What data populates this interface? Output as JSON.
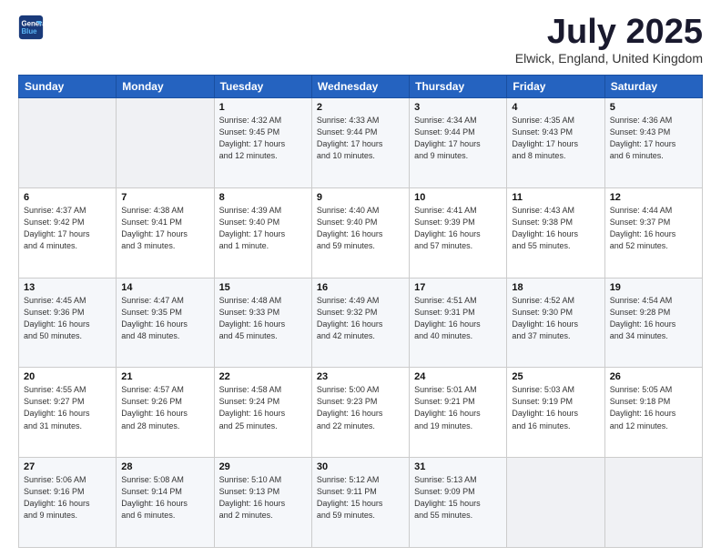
{
  "header": {
    "logo_line1": "General",
    "logo_line2": "Blue",
    "month": "July 2025",
    "location": "Elwick, England, United Kingdom"
  },
  "days_of_week": [
    "Sunday",
    "Monday",
    "Tuesday",
    "Wednesday",
    "Thursday",
    "Friday",
    "Saturday"
  ],
  "weeks": [
    [
      {
        "num": "",
        "info": ""
      },
      {
        "num": "",
        "info": ""
      },
      {
        "num": "1",
        "info": "Sunrise: 4:32 AM\nSunset: 9:45 PM\nDaylight: 17 hours\nand 12 minutes."
      },
      {
        "num": "2",
        "info": "Sunrise: 4:33 AM\nSunset: 9:44 PM\nDaylight: 17 hours\nand 10 minutes."
      },
      {
        "num": "3",
        "info": "Sunrise: 4:34 AM\nSunset: 9:44 PM\nDaylight: 17 hours\nand 9 minutes."
      },
      {
        "num": "4",
        "info": "Sunrise: 4:35 AM\nSunset: 9:43 PM\nDaylight: 17 hours\nand 8 minutes."
      },
      {
        "num": "5",
        "info": "Sunrise: 4:36 AM\nSunset: 9:43 PM\nDaylight: 17 hours\nand 6 minutes."
      }
    ],
    [
      {
        "num": "6",
        "info": "Sunrise: 4:37 AM\nSunset: 9:42 PM\nDaylight: 17 hours\nand 4 minutes."
      },
      {
        "num": "7",
        "info": "Sunrise: 4:38 AM\nSunset: 9:41 PM\nDaylight: 17 hours\nand 3 minutes."
      },
      {
        "num": "8",
        "info": "Sunrise: 4:39 AM\nSunset: 9:40 PM\nDaylight: 17 hours\nand 1 minute."
      },
      {
        "num": "9",
        "info": "Sunrise: 4:40 AM\nSunset: 9:40 PM\nDaylight: 16 hours\nand 59 minutes."
      },
      {
        "num": "10",
        "info": "Sunrise: 4:41 AM\nSunset: 9:39 PM\nDaylight: 16 hours\nand 57 minutes."
      },
      {
        "num": "11",
        "info": "Sunrise: 4:43 AM\nSunset: 9:38 PM\nDaylight: 16 hours\nand 55 minutes."
      },
      {
        "num": "12",
        "info": "Sunrise: 4:44 AM\nSunset: 9:37 PM\nDaylight: 16 hours\nand 52 minutes."
      }
    ],
    [
      {
        "num": "13",
        "info": "Sunrise: 4:45 AM\nSunset: 9:36 PM\nDaylight: 16 hours\nand 50 minutes."
      },
      {
        "num": "14",
        "info": "Sunrise: 4:47 AM\nSunset: 9:35 PM\nDaylight: 16 hours\nand 48 minutes."
      },
      {
        "num": "15",
        "info": "Sunrise: 4:48 AM\nSunset: 9:33 PM\nDaylight: 16 hours\nand 45 minutes."
      },
      {
        "num": "16",
        "info": "Sunrise: 4:49 AM\nSunset: 9:32 PM\nDaylight: 16 hours\nand 42 minutes."
      },
      {
        "num": "17",
        "info": "Sunrise: 4:51 AM\nSunset: 9:31 PM\nDaylight: 16 hours\nand 40 minutes."
      },
      {
        "num": "18",
        "info": "Sunrise: 4:52 AM\nSunset: 9:30 PM\nDaylight: 16 hours\nand 37 minutes."
      },
      {
        "num": "19",
        "info": "Sunrise: 4:54 AM\nSunset: 9:28 PM\nDaylight: 16 hours\nand 34 minutes."
      }
    ],
    [
      {
        "num": "20",
        "info": "Sunrise: 4:55 AM\nSunset: 9:27 PM\nDaylight: 16 hours\nand 31 minutes."
      },
      {
        "num": "21",
        "info": "Sunrise: 4:57 AM\nSunset: 9:26 PM\nDaylight: 16 hours\nand 28 minutes."
      },
      {
        "num": "22",
        "info": "Sunrise: 4:58 AM\nSunset: 9:24 PM\nDaylight: 16 hours\nand 25 minutes."
      },
      {
        "num": "23",
        "info": "Sunrise: 5:00 AM\nSunset: 9:23 PM\nDaylight: 16 hours\nand 22 minutes."
      },
      {
        "num": "24",
        "info": "Sunrise: 5:01 AM\nSunset: 9:21 PM\nDaylight: 16 hours\nand 19 minutes."
      },
      {
        "num": "25",
        "info": "Sunrise: 5:03 AM\nSunset: 9:19 PM\nDaylight: 16 hours\nand 16 minutes."
      },
      {
        "num": "26",
        "info": "Sunrise: 5:05 AM\nSunset: 9:18 PM\nDaylight: 16 hours\nand 12 minutes."
      }
    ],
    [
      {
        "num": "27",
        "info": "Sunrise: 5:06 AM\nSunset: 9:16 PM\nDaylight: 16 hours\nand 9 minutes."
      },
      {
        "num": "28",
        "info": "Sunrise: 5:08 AM\nSunset: 9:14 PM\nDaylight: 16 hours\nand 6 minutes."
      },
      {
        "num": "29",
        "info": "Sunrise: 5:10 AM\nSunset: 9:13 PM\nDaylight: 16 hours\nand 2 minutes."
      },
      {
        "num": "30",
        "info": "Sunrise: 5:12 AM\nSunset: 9:11 PM\nDaylight: 15 hours\nand 59 minutes."
      },
      {
        "num": "31",
        "info": "Sunrise: 5:13 AM\nSunset: 9:09 PM\nDaylight: 15 hours\nand 55 minutes."
      },
      {
        "num": "",
        "info": ""
      },
      {
        "num": "",
        "info": ""
      }
    ]
  ]
}
